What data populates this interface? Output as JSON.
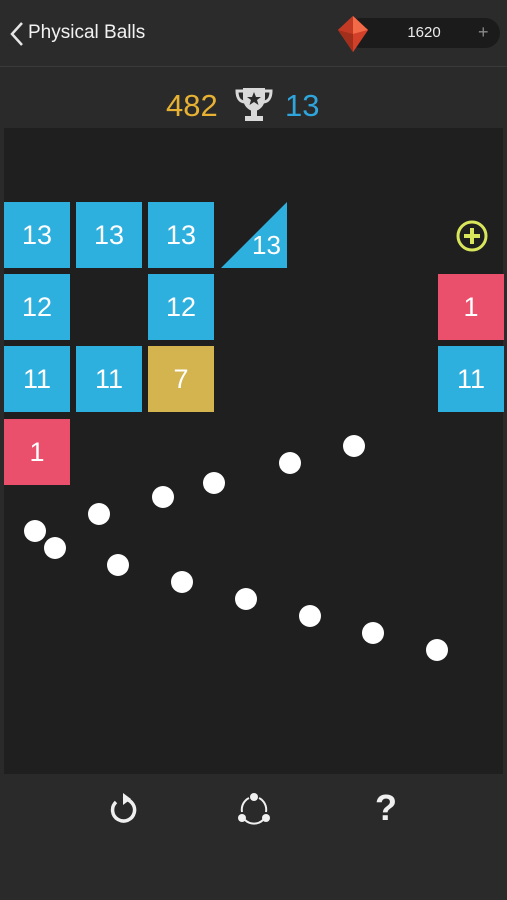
{
  "header": {
    "back_icon": "chevron-left-icon",
    "title": "Physical Balls",
    "gem_icon": "red-gem-icon",
    "gem_count": "1620",
    "add_label": "+"
  },
  "score": {
    "current": "482",
    "trophy_icon": "trophy-icon",
    "best": "13"
  },
  "board": {
    "blocks": [
      {
        "value": "13",
        "color": "#2eb0df"
      },
      {
        "value": "13",
        "color": "#2eb0df"
      },
      {
        "value": "13",
        "color": "#2eb0df"
      },
      {
        "value": "13",
        "color": "#2eb0df",
        "shape": "triangle"
      },
      {
        "value": "12",
        "color": "#2eb0df"
      },
      {
        "value": "12",
        "color": "#2eb0df"
      },
      {
        "value": "1",
        "color": "#ea4f6c"
      },
      {
        "value": "11",
        "color": "#2eb0df"
      },
      {
        "value": "11",
        "color": "#2eb0df"
      },
      {
        "value": "7",
        "color": "#d3b44f"
      },
      {
        "value": "11",
        "color": "#2eb0df"
      },
      {
        "value": "1",
        "color": "#ea4f6c"
      }
    ],
    "pickup_icon": "plus-circle-icon",
    "ball_color": "#ffffff"
  },
  "toolbar": {
    "restart_icon": "restart-icon",
    "share_icon": "share-icon",
    "help_label": "?"
  }
}
